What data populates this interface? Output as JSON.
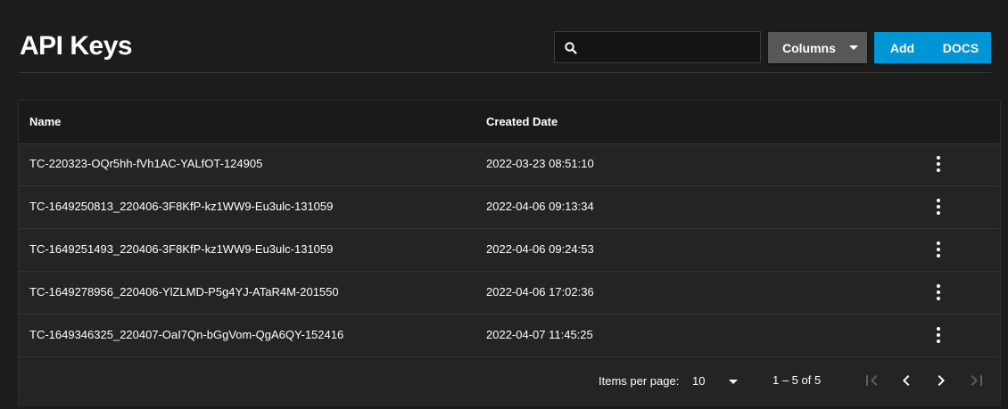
{
  "header": {
    "title": "API Keys",
    "search_placeholder": "",
    "columns_label": "Columns",
    "add_label": "Add",
    "docs_label": "DOCS"
  },
  "table": {
    "columns": [
      "Name",
      "Created Date"
    ],
    "rows": [
      {
        "name": "TC-220323-OQr5hh-fVh1AC-YALfOT-124905",
        "created": "2022-03-23 08:51:10"
      },
      {
        "name": "TC-1649250813_220406-3F8KfP-kz1WW9-Eu3ulc-131059",
        "created": "2022-04-06 09:13:34"
      },
      {
        "name": "TC-1649251493_220406-3F8KfP-kz1WW9-Eu3ulc-131059",
        "created": "2022-04-06 09:24:53"
      },
      {
        "name": "TC-1649278956_220406-YlZLMD-P5g4YJ-ATaR4M-201550",
        "created": "2022-04-06 17:02:36"
      },
      {
        "name": "TC-1649346325_220407-OaI7Qn-bGgVom-QgA6QY-152416",
        "created": "2022-04-07 11:45:25"
      }
    ]
  },
  "paginator": {
    "items_per_page_label": "Items per page:",
    "page_size": "10",
    "range_label": "1 – 5 of 5"
  },
  "icons": {
    "search": "search-icon",
    "row_menu": "more-vert-icon",
    "first": "first-page-icon",
    "prev": "chevron-left-icon",
    "next": "chevron-right-icon",
    "last": "last-page-icon"
  },
  "colors": {
    "accent": "#0095d5",
    "background": "#1c1c1c",
    "card": "#242424"
  }
}
